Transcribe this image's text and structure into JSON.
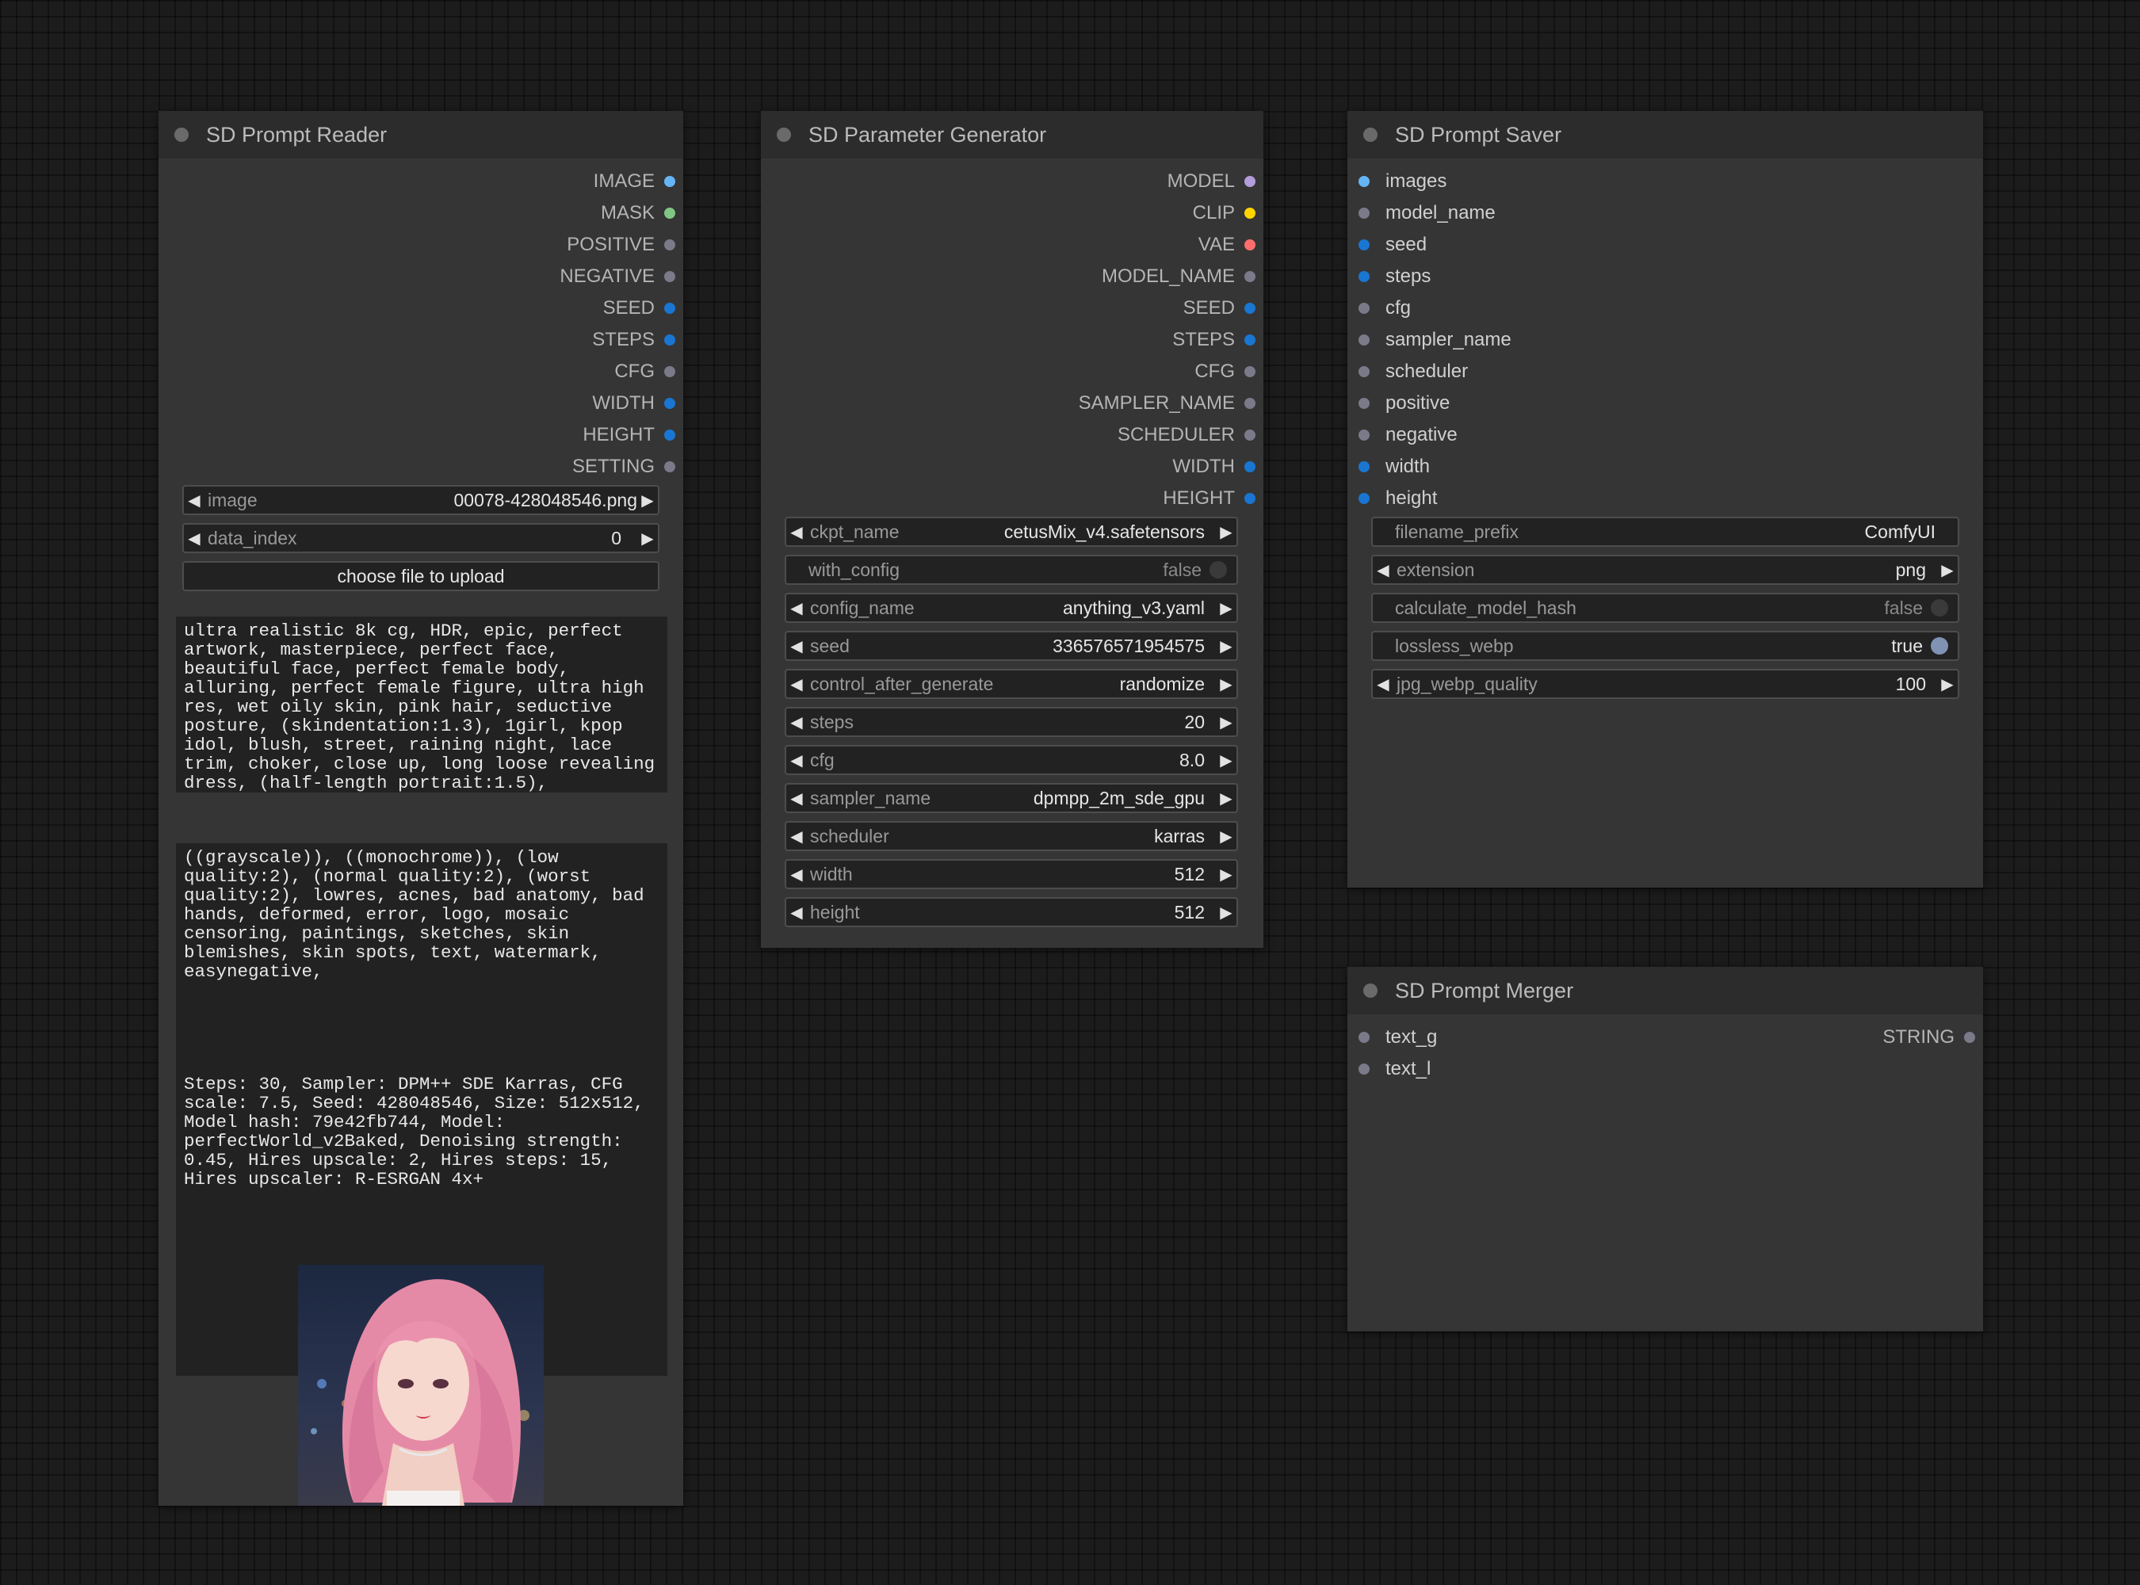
{
  "reader": {
    "title": "SD Prompt Reader",
    "outputs": [
      {
        "label": "IMAGE",
        "color": "#64b5f6"
      },
      {
        "label": "MASK",
        "color": "#81c784"
      },
      {
        "label": "POSITIVE",
        "color": "#7a7a8a"
      },
      {
        "label": "NEGATIVE",
        "color": "#7a7a8a"
      },
      {
        "label": "SEED",
        "color": "#1976d2"
      },
      {
        "label": "STEPS",
        "color": "#1976d2"
      },
      {
        "label": "CFG",
        "color": "#7a7a8a"
      },
      {
        "label": "WIDTH",
        "color": "#1976d2"
      },
      {
        "label": "HEIGHT",
        "color": "#1976d2"
      },
      {
        "label": "SETTING",
        "color": "#7a7a8a"
      }
    ],
    "image_widget": {
      "label": "image",
      "value": "00078-428048546.png"
    },
    "data_index_widget": {
      "label": "data_index",
      "value": "0"
    },
    "upload_button": "choose file to upload",
    "positive_text": "ultra realistic 8k cg, HDR, epic, perfect artwork, masterpiece, perfect face, beautiful face, perfect female body, alluring, perfect female figure, ultra high res, wet oily skin, pink hair, seductive posture, (skindentation:1.3), 1girl, kpop idol, blush, street, raining night, lace trim, choker, close up, long loose revealing dress, (half-length portrait:1.5),",
    "negative_text": "((grayscale)), ((monochrome)), (low quality:2), (normal quality:2), (worst quality:2), lowres, acnes, bad anatomy, bad hands, deformed, error, logo, mosaic censoring, paintings, sketches, skin blemishes, skin spots, text, watermark, easynegative,",
    "setting_text": "Steps: 30, Sampler: DPM++ SDE Karras, CFG scale: 7.5, Seed: 428048546, Size: 512x512, Model hash: 79e42fb744, Model: perfectWorld_v2Baked, Denoising strength: 0.45, Hires upscale: 2, Hires steps: 15, Hires upscaler: R-ESRGAN 4x+"
  },
  "generator": {
    "title": "SD Parameter Generator",
    "outputs": [
      {
        "label": "MODEL",
        "color": "#b39ddb"
      },
      {
        "label": "CLIP",
        "color": "#ffd500"
      },
      {
        "label": "VAE",
        "color": "#ff6e6e"
      },
      {
        "label": "MODEL_NAME",
        "color": "#7a7a8a"
      },
      {
        "label": "SEED",
        "color": "#1976d2"
      },
      {
        "label": "STEPS",
        "color": "#1976d2"
      },
      {
        "label": "CFG",
        "color": "#7a7a8a"
      },
      {
        "label": "SAMPLER_NAME",
        "color": "#7a7a8a"
      },
      {
        "label": "SCHEDULER",
        "color": "#7a7a8a"
      },
      {
        "label": "WIDTH",
        "color": "#1976d2"
      },
      {
        "label": "HEIGHT",
        "color": "#1976d2"
      }
    ],
    "widgets": [
      {
        "label": "ckpt_name",
        "value": "cetusMix_v4.safetensors",
        "kind": "combo"
      },
      {
        "label": "with_config",
        "value": "false",
        "kind": "toggle",
        "on": false
      },
      {
        "label": "config_name",
        "value": "anything_v3.yaml",
        "kind": "combo"
      },
      {
        "label": "seed",
        "value": "336576571954575",
        "kind": "combo"
      },
      {
        "label": "control_after_generate",
        "value": "randomize",
        "kind": "combo"
      },
      {
        "label": "steps",
        "value": "20",
        "kind": "combo"
      },
      {
        "label": "cfg",
        "value": "8.0",
        "kind": "combo"
      },
      {
        "label": "sampler_name",
        "value": "dpmpp_2m_sde_gpu",
        "kind": "combo"
      },
      {
        "label": "scheduler",
        "value": "karras",
        "kind": "combo"
      },
      {
        "label": "width",
        "value": "512",
        "kind": "combo"
      },
      {
        "label": "height",
        "value": "512",
        "kind": "combo"
      }
    ]
  },
  "saver": {
    "title": "SD Prompt Saver",
    "inputs": [
      {
        "label": "images",
        "color": "#64b5f6"
      },
      {
        "label": "model_name",
        "color": "#7a7a8a"
      },
      {
        "label": "seed",
        "color": "#1976d2"
      },
      {
        "label": "steps",
        "color": "#1976d2"
      },
      {
        "label": "cfg",
        "color": "#7a7a8a"
      },
      {
        "label": "sampler_name",
        "color": "#7a7a8a"
      },
      {
        "label": "scheduler",
        "color": "#7a7a8a"
      },
      {
        "label": "positive",
        "color": "#7a7a8a"
      },
      {
        "label": "negative",
        "color": "#7a7a8a"
      },
      {
        "label": "width",
        "color": "#1976d2"
      },
      {
        "label": "height",
        "color": "#1976d2"
      }
    ],
    "widgets": [
      {
        "label": "filename_prefix",
        "value": "ComfyUI",
        "kind": "text"
      },
      {
        "label": "extension",
        "value": "png",
        "kind": "combo"
      },
      {
        "label": "calculate_model_hash",
        "value": "false",
        "kind": "toggle",
        "on": false
      },
      {
        "label": "lossless_webp",
        "value": "true",
        "kind": "toggle",
        "on": true
      },
      {
        "label": "jpg_webp_quality",
        "value": "100",
        "kind": "combo"
      }
    ]
  },
  "merger": {
    "title": "SD Prompt Merger",
    "inputs": [
      {
        "label": "text_g",
        "color": "#7a7a8a"
      },
      {
        "label": "text_l",
        "color": "#7a7a8a"
      }
    ],
    "outputs": [
      {
        "label": "STRING",
        "color": "#7a7a8a"
      }
    ]
  }
}
